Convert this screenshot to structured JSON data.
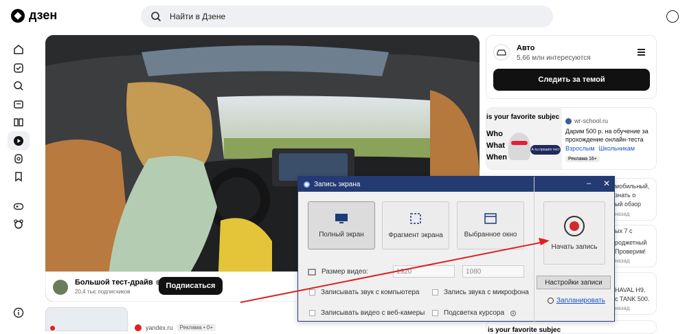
{
  "header": {
    "logo_text": "дзен",
    "search_placeholder": "Найти в Дзене"
  },
  "sidebar": {
    "items": [
      "home-icon",
      "subscriptions-icon",
      "search-icon",
      "news-icon",
      "articles-icon",
      "video-icon",
      "shorts-icon",
      "bookmark-icon",
      "games-icon",
      "kids-icon",
      "info-icon"
    ]
  },
  "video": {
    "channel_name": "Большой тест-драйв",
    "channel_subs": "20,4 тыс подписчиков",
    "subscribe_label": "Подписаться"
  },
  "feed": {
    "next_source": "yandex.ru",
    "next_ad_label": "Реклама • 0+"
  },
  "topic_card": {
    "title": "Авто",
    "subtitle": "5,66 млн интересуются",
    "follow_label": "Следить за темой"
  },
  "ad_card": {
    "image_text_top": "is your favorite subjec",
    "image_text_lines": [
      "Who",
      "What",
      "When"
    ],
    "cat_label": "A ты прошёл тест",
    "source": "wr-school.ru",
    "text": "Дарим 500 р. на обучение за прохождение онлайн-теста",
    "link1": "Взрослым",
    "link2": "Школьникам",
    "badge": "Реклама 16+"
  },
  "side_cards": [
    {
      "lines": [
        "мобильный,",
        "знать о",
        "ый обзор"
      ],
      "meta": "назад"
    },
    {
      "lines": [
        "роджетный",
        "ых 7 с",
        "Проверим!"
      ],
      "meta": "назад"
    },
    {
      "lines": [
        "HAVAL H9.",
        "с TANK 500."
      ],
      "meta": "назад"
    }
  ],
  "bottom_right_text": "is your favorite subjec",
  "rec_window": {
    "title": "Запись экрана",
    "mode_full": "Полный экран",
    "mode_fragment": "Фрагмент экрана",
    "mode_window": "Выбранное окно",
    "size_label": "Размер видео:",
    "width_value": "1920",
    "height_value": "1080",
    "chk_sound_pc": "Записывать звук с компьютера",
    "chk_sound_mic": "Запись звука с микрофона",
    "chk_webcam": "Записывать видео с веб-камеры",
    "chk_cursor": "Подсветка курсора",
    "start_label": "Начать запись",
    "settings_label": "Настройки записи",
    "schedule_label": "Запланировать"
  },
  "colors": {
    "rec_titlebar": "#233a73",
    "rec_dot": "#d12a2a",
    "arrow": "#e02020",
    "link_blue": "#1a55c4"
  }
}
